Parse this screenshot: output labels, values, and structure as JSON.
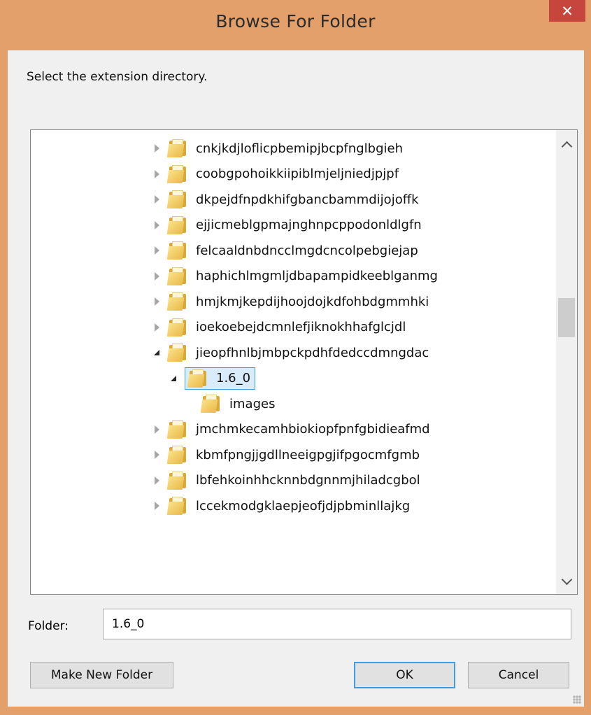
{
  "dialog": {
    "title": "Browse For Folder",
    "close_label": "✕",
    "prompt": "Select the extension directory."
  },
  "tree": {
    "items": [
      {
        "label": "cnkjkdjloflicpbemipjbcpfnglbgieh",
        "level": 0,
        "state": "collapsed"
      },
      {
        "label": "coobgpohoikkiipiblmjeljniedjpjpf",
        "level": 0,
        "state": "collapsed"
      },
      {
        "label": "dkpejdfnpdkhifgbancbammdijojoffk",
        "level": 0,
        "state": "collapsed"
      },
      {
        "label": "ejjicmeblgpmajnghnpcppodonldlgfn",
        "level": 0,
        "state": "collapsed"
      },
      {
        "label": "felcaaldnbdncclmgdcncolpebgiejap",
        "level": 0,
        "state": "collapsed"
      },
      {
        "label": "haphichlmgmljdbapampidkeeblganmg",
        "level": 0,
        "state": "collapsed"
      },
      {
        "label": "hmjkmjkepdijhoojdojkdfohbdgmmhki",
        "level": 0,
        "state": "collapsed"
      },
      {
        "label": "ioekoebejdcmnlefjiknokhhafglcjdl",
        "level": 0,
        "state": "collapsed"
      },
      {
        "label": "jieopfhnlbjmbpckpdhfdedccdmngdac",
        "level": 0,
        "state": "expanded"
      },
      {
        "label": "1.6_0",
        "level": 1,
        "state": "expanded",
        "selected": true
      },
      {
        "label": "images",
        "level": 2,
        "state": "none"
      },
      {
        "label": "jmchmkecamhbiokiopfpnfgbidieafmd",
        "level": 0,
        "state": "collapsed"
      },
      {
        "label": "kbmfpngjjgdllneeigpgjifpgocmfgmb",
        "level": 0,
        "state": "collapsed"
      },
      {
        "label": "lbfehkoinhhcknnbdgnnmjhiladcgbol",
        "level": 0,
        "state": "collapsed"
      },
      {
        "label": "lccekmodgklaepjeofjdjpbminllajkg",
        "level": 0,
        "state": "collapsed"
      }
    ]
  },
  "folder_field": {
    "label": "Folder:",
    "value": "1.6_0"
  },
  "buttons": {
    "make_new_folder": "Make New Folder",
    "ok": "OK",
    "cancel": "Cancel"
  },
  "colors": {
    "title_bar": "#e4a06a",
    "close_button": "#c6463e",
    "selection_border": "#3c9ee0",
    "selection_fill": "#d9ecfb"
  }
}
